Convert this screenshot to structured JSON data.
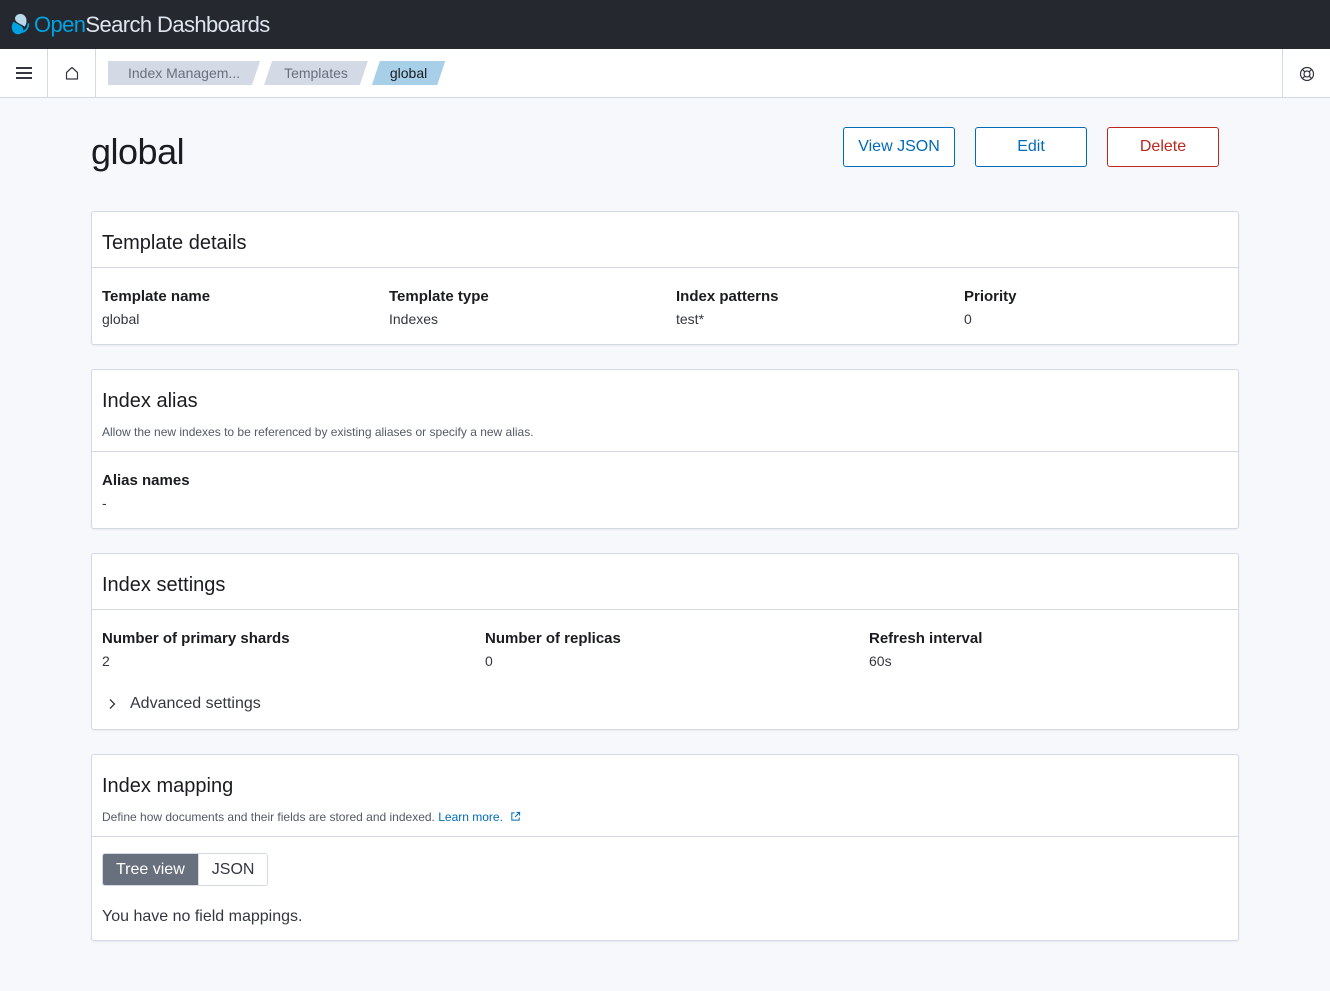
{
  "app": {
    "logo_open": "Open",
    "logo_rest": "Search Dashboards"
  },
  "breadcrumbs": [
    {
      "label": "Index Managem..."
    },
    {
      "label": "Templates"
    },
    {
      "label": "global"
    }
  ],
  "page": {
    "title": "global",
    "actions": {
      "view_json": "View JSON",
      "edit": "Edit",
      "delete": "Delete"
    }
  },
  "template_details": {
    "title": "Template details",
    "fields": [
      {
        "label": "Template name",
        "value": "global"
      },
      {
        "label": "Template type",
        "value": "Indexes"
      },
      {
        "label": "Index patterns",
        "value": "test*"
      },
      {
        "label": "Priority",
        "value": "0"
      }
    ]
  },
  "index_alias": {
    "title": "Index alias",
    "description": "Allow the new indexes to be referenced by existing aliases or specify a new alias.",
    "field": {
      "label": "Alias names",
      "value": "-"
    }
  },
  "index_settings": {
    "title": "Index settings",
    "fields": [
      {
        "label": "Number of primary shards",
        "value": "2"
      },
      {
        "label": "Number of replicas",
        "value": "0"
      },
      {
        "label": "Refresh interval",
        "value": "60s"
      }
    ],
    "advanced_label": "Advanced settings"
  },
  "index_mapping": {
    "title": "Index mapping",
    "description": "Define how documents and their fields are stored and indexed.",
    "learn_more": "Learn more.",
    "view_options": [
      {
        "label": "Tree view",
        "selected": true
      },
      {
        "label": "JSON",
        "selected": false
      }
    ],
    "empty_message": "You have no field mappings."
  },
  "icons": {
    "menu": "menu-icon",
    "home": "home-icon",
    "help": "help-icon",
    "chevron": "chevron-right-icon",
    "external": "external-link-icon"
  },
  "colors": {
    "header_bg": "#25282f",
    "primary": "#006bb8",
    "danger": "#bd271e",
    "brand": "#00a3e0"
  }
}
